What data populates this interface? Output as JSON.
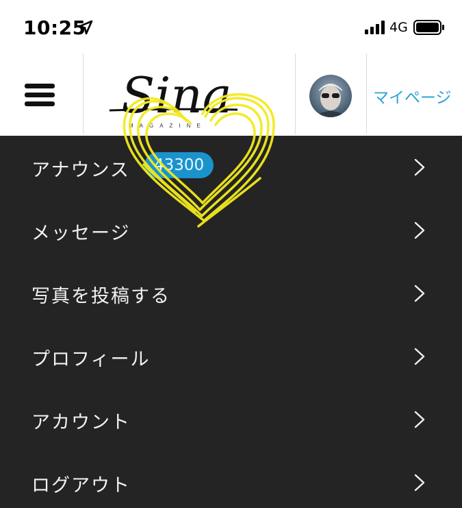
{
  "status_bar": {
    "time": "10:25",
    "network": "4G",
    "icons": [
      "location-arrow-icon",
      "signal-bars-icon",
      "battery-icon"
    ]
  },
  "header": {
    "logo_text": "Sina",
    "logo_subtext": "MAGAZINE",
    "mypage_label": "マイページ",
    "icons": [
      "hamburger-menu-icon",
      "user-avatar"
    ]
  },
  "menu": {
    "items": [
      {
        "label": "アナウンス",
        "badge": "43300"
      },
      {
        "label": "メッセージ"
      },
      {
        "label": "写真を投稿する"
      },
      {
        "label": "プロフィール"
      },
      {
        "label": "アカウント"
      },
      {
        "label": "ログアウト"
      }
    ],
    "chevron_icon": "chevron-right-icon"
  },
  "colors": {
    "menu_background": "#242424",
    "menu_text": "#f2f2f2",
    "badge_background": "#1a93cc",
    "link_accent": "#2aa3d8",
    "heart_scribble": "#f2ea1d"
  }
}
